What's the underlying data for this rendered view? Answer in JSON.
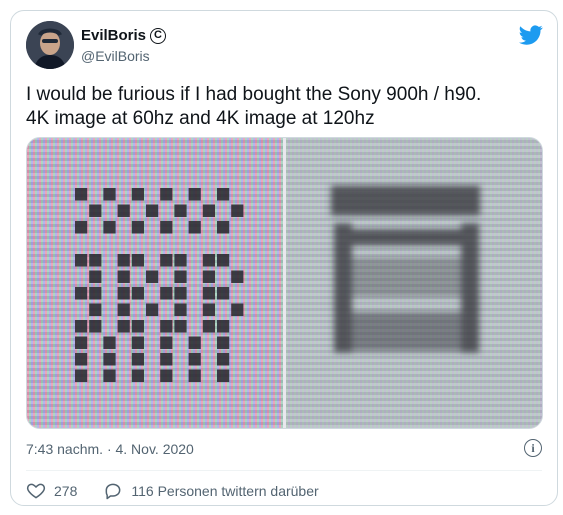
{
  "author": {
    "name": "EvilBoris",
    "handle": "@EvilBoris"
  },
  "tweet": {
    "lines": [
      "I would be furious if I had bought the Sony 900h / h90.",
      "4K image at 60hz and 4K image at 120hz"
    ],
    "timestamp": "7:43 nachm. · 4. Nov. 2020"
  },
  "actions": {
    "likes": "278",
    "retweets_label": "116 Personen twittern darüber"
  },
  "icons": {
    "brand": "twitter-bird-icon",
    "verified": "copyright-icon",
    "info": "info-icon",
    "like": "heart-icon",
    "reply": "comment-icon"
  },
  "colors": {
    "twitter_blue": "#1d9bf0",
    "text": "#0f1419",
    "muted": "#536471"
  },
  "media": {
    "left_pattern_rows": [
      [
        1,
        0,
        1,
        0,
        1,
        0,
        1,
        0,
        1,
        0,
        1,
        0
      ],
      [
        0,
        1,
        0,
        1,
        0,
        1,
        0,
        1,
        0,
        1,
        0,
        1
      ],
      [
        1,
        0,
        1,
        0,
        1,
        0,
        1,
        0,
        1,
        0,
        1,
        0
      ],
      [
        0,
        0,
        0,
        0,
        0,
        0,
        0,
        0,
        0,
        0,
        0,
        0
      ],
      [
        1,
        1,
        0,
        1,
        1,
        0,
        1,
        1,
        0,
        1,
        1,
        0
      ],
      [
        0,
        1,
        0,
        1,
        0,
        1,
        0,
        1,
        0,
        1,
        0,
        1
      ],
      [
        1,
        1,
        0,
        1,
        1,
        0,
        1,
        1,
        0,
        1,
        1,
        0
      ],
      [
        0,
        1,
        0,
        1,
        0,
        1,
        0,
        1,
        0,
        1,
        0,
        1
      ],
      [
        1,
        1,
        0,
        1,
        1,
        0,
        1,
        1,
        0,
        1,
        1,
        0
      ],
      [
        1,
        0,
        1,
        0,
        1,
        0,
        1,
        0,
        1,
        0,
        1,
        0
      ],
      [
        1,
        0,
        1,
        0,
        1,
        0,
        1,
        0,
        1,
        0,
        1,
        0
      ],
      [
        1,
        0,
        1,
        0,
        1,
        0,
        1,
        0,
        1,
        0,
        1,
        0
      ]
    ]
  }
}
